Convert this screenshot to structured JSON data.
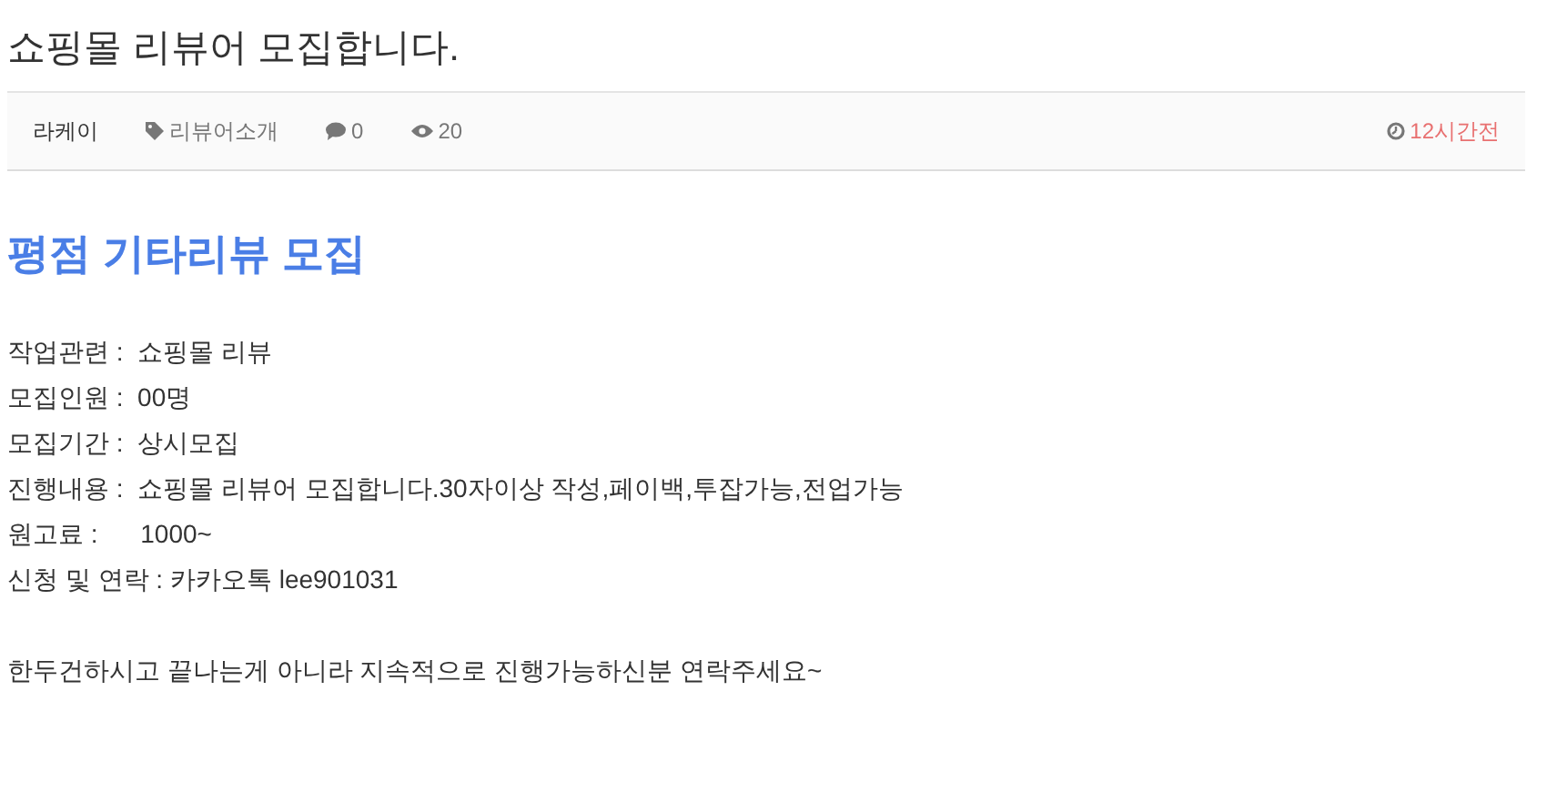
{
  "title": "쇼핑몰 리뷰어 모집합니다.",
  "meta": {
    "author": "라케이",
    "category": "리뷰어소개",
    "comments": "0",
    "views": "20",
    "time": "12시간전"
  },
  "heading": "평점 기타리뷰 모집",
  "lines": [
    "작업관련 :  쇼핑몰 리뷰",
    "모집인원 :  00명",
    "모집기간 :  상시모집",
    "진행내용 :  쇼핑몰 리뷰어 모집합니다.30자이상 작성,페이백,투잡가능,전업가능",
    "원고료 :      1000~",
    "신청 및 연락 : 카카오톡 lee901031"
  ],
  "closing": "한두건하시고 끝나는게 아니라 지속적으로 진행가능하신분 연락주세요~"
}
